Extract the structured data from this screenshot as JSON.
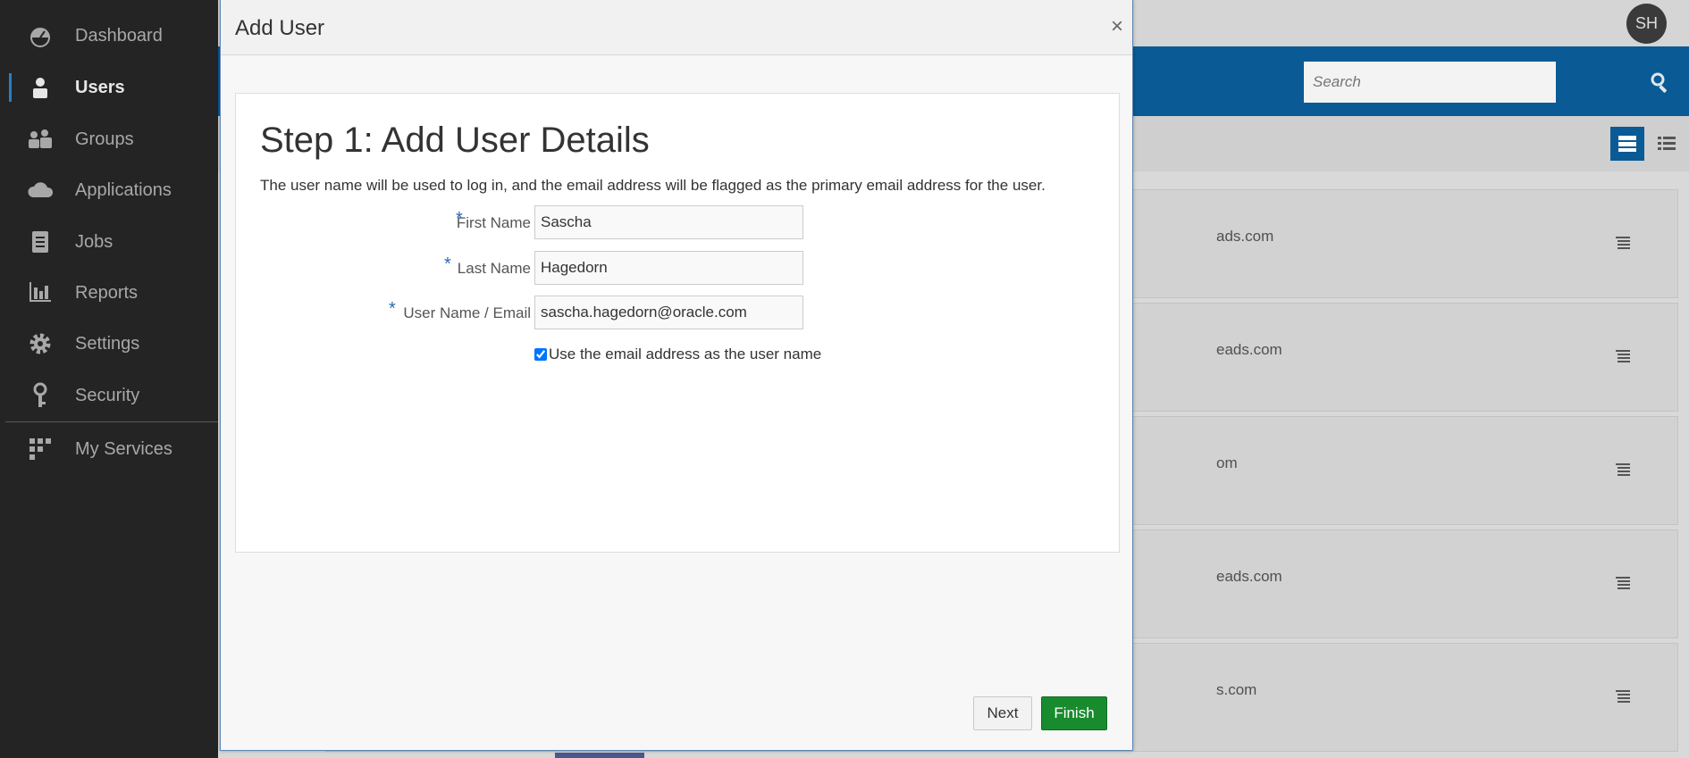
{
  "sidebar": {
    "items": [
      {
        "label": "Dashboard",
        "icon": "dashboard-icon"
      },
      {
        "label": "Users",
        "icon": "user-icon",
        "active": true
      },
      {
        "label": "Groups",
        "icon": "groups-icon"
      },
      {
        "label": "Applications",
        "icon": "cloud-icon"
      },
      {
        "label": "Jobs",
        "icon": "jobs-icon"
      },
      {
        "label": "Reports",
        "icon": "reports-icon"
      },
      {
        "label": "Settings",
        "icon": "gear-icon"
      },
      {
        "label": "Security",
        "icon": "key-icon"
      },
      {
        "label": "My Services",
        "icon": "grid-icon"
      }
    ]
  },
  "header": {
    "avatar_initials": "SH",
    "search_placeholder": "Search"
  },
  "list": {
    "rows": [
      {
        "email_suffix": "ads.com"
      },
      {
        "email_suffix": "eads.com"
      },
      {
        "email_suffix": "om"
      },
      {
        "email_suffix": "eads.com"
      },
      {
        "email_suffix": "s.com"
      }
    ]
  },
  "dialog": {
    "title": "Add User",
    "close_glyph": "×",
    "step_title": "Step 1: Add User Details",
    "step_description": "The user name will be used to log in, and the email address will be flagged as the primary email address for the user.",
    "fields": {
      "first_name": {
        "label": "First Name",
        "value": "Sascha"
      },
      "last_name": {
        "label": "Last Name",
        "value": "Hagedorn"
      },
      "username": {
        "label": "User Name / Email",
        "value": "sascha.hagedorn@oracle.com"
      }
    },
    "required_marker": "*",
    "use_email_checkbox": {
      "label": "Use the email address as the user name",
      "checked": true
    },
    "next_label": "Next",
    "finish_label": "Finish"
  },
  "colors": {
    "sidebar_bg": "#242424",
    "brand_blue": "#0a5a96",
    "finish_green": "#188b2e",
    "required_blue": "#2a6bb3"
  }
}
